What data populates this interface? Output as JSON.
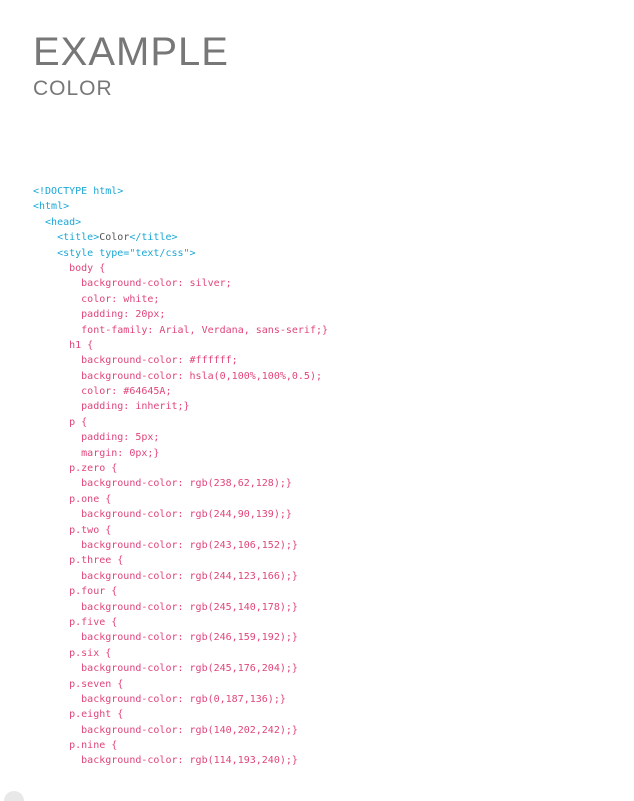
{
  "heading": {
    "title": "EXAMPLE",
    "subtitle": "COLOR"
  },
  "colors": {
    "html_tag": "#1aa7d6",
    "text": "#555555",
    "css": "#e0457b",
    "heading": "#777777"
  },
  "code_lines": [
    [
      {
        "t": "<!DOCTYPE html>",
        "c": "blue"
      }
    ],
    [
      {
        "t": "<html>",
        "c": "blue"
      }
    ],
    [
      {
        "t": "  <head>",
        "c": "blue"
      }
    ],
    [
      {
        "t": "    <title>",
        "c": "blue"
      },
      {
        "t": "Color",
        "c": "dark"
      },
      {
        "t": "</title>",
        "c": "blue"
      }
    ],
    [
      {
        "t": "    <style type=\"text/css\">",
        "c": "blue"
      }
    ],
    [
      {
        "t": "      body {",
        "c": "pink"
      }
    ],
    [
      {
        "t": "        background-color: silver;",
        "c": "pink"
      }
    ],
    [
      {
        "t": "        color: white;",
        "c": "pink"
      }
    ],
    [
      {
        "t": "        padding: 20px;",
        "c": "pink"
      }
    ],
    [
      {
        "t": "        font-family: Arial, Verdana, sans-serif;}",
        "c": "pink"
      }
    ],
    [
      {
        "t": "      h1 {",
        "c": "pink"
      }
    ],
    [
      {
        "t": "        background-color: #ffffff;",
        "c": "pink"
      }
    ],
    [
      {
        "t": "        background-color: hsla(0,100%,100%,0.5);",
        "c": "pink"
      }
    ],
    [
      {
        "t": "        color: #64645A;",
        "c": "pink"
      }
    ],
    [
      {
        "t": "        padding: inherit;}",
        "c": "pink"
      }
    ],
    [
      {
        "t": "      p {",
        "c": "pink"
      }
    ],
    [
      {
        "t": "        padding: 5px;",
        "c": "pink"
      }
    ],
    [
      {
        "t": "        margin: 0px;}",
        "c": "pink"
      }
    ],
    [
      {
        "t": "      p.zero {",
        "c": "pink"
      }
    ],
    [
      {
        "t": "        background-color: rgb(238,62,128);}",
        "c": "pink"
      }
    ],
    [
      {
        "t": "      p.one {",
        "c": "pink"
      }
    ],
    [
      {
        "t": "        background-color: rgb(244,90,139);}",
        "c": "pink"
      }
    ],
    [
      {
        "t": "      p.two {",
        "c": "pink"
      }
    ],
    [
      {
        "t": "        background-color: rgb(243,106,152);}",
        "c": "pink"
      }
    ],
    [
      {
        "t": "      p.three {",
        "c": "pink"
      }
    ],
    [
      {
        "t": "        background-color: rgb(244,123,166);}",
        "c": "pink"
      }
    ],
    [
      {
        "t": "      p.four {",
        "c": "pink"
      }
    ],
    [
      {
        "t": "        background-color: rgb(245,140,178);}",
        "c": "pink"
      }
    ],
    [
      {
        "t": "      p.five {",
        "c": "pink"
      }
    ],
    [
      {
        "t": "        background-color: rgb(246,159,192);}",
        "c": "pink"
      }
    ],
    [
      {
        "t": "      p.six {",
        "c": "pink"
      }
    ],
    [
      {
        "t": "        background-color: rgb(245,176,204);}",
        "c": "pink"
      }
    ],
    [
      {
        "t": "      p.seven {",
        "c": "pink"
      }
    ],
    [
      {
        "t": "        background-color: rgb(0,187,136);}",
        "c": "pink"
      }
    ],
    [
      {
        "t": "      p.eight {",
        "c": "pink"
      }
    ],
    [
      {
        "t": "        background-color: rgb(140,202,242);}",
        "c": "pink"
      }
    ],
    [
      {
        "t": "      p.nine {",
        "c": "pink"
      }
    ],
    [
      {
        "t": "        background-color: rgb(114,193,240);}",
        "c": "pink"
      }
    ]
  ]
}
